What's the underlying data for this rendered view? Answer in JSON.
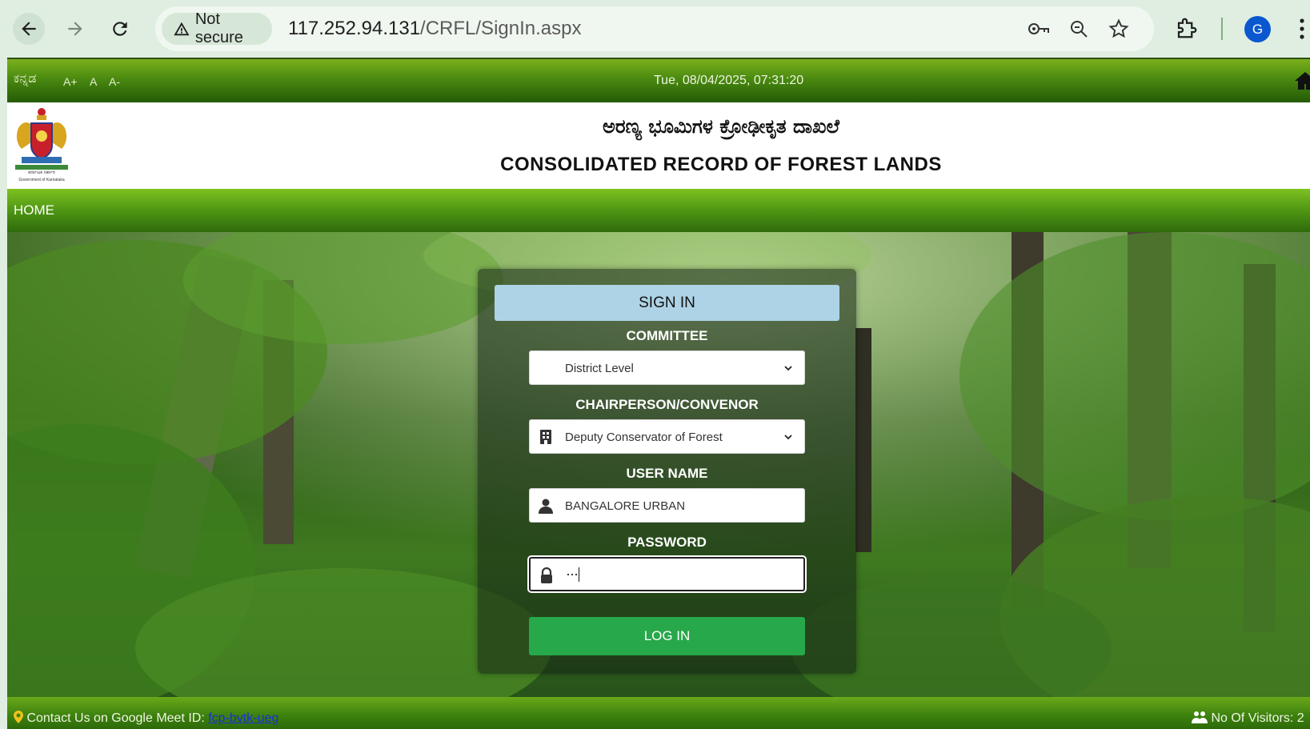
{
  "browser": {
    "security_label": "Not secure",
    "url_host": "117.252.94.131",
    "url_path": "/CRFL/SignIn.aspx",
    "profile_initial": "G"
  },
  "topbar": {
    "language_link": "ಕನ್ನಡ",
    "font_increase": "A+",
    "font_normal": "A",
    "font_decrease": "A-",
    "datetime": "Tue, 08/04/2025, 07:31:20"
  },
  "header": {
    "title_kannada": "ಅರಣ್ಯ ಭೂಮಿಗಳ ಕ್ರೋಢೀಕೃತ ದಾಖಲೆ",
    "title_english": "CONSOLIDATED RECORD OF FOREST LANDS",
    "emblem_caption_kn": "ಕರ್ನಾಟಕ ಸರ್ಕಾರ",
    "emblem_caption_en": "Government of Karnataka"
  },
  "menu": {
    "home": "HOME"
  },
  "login": {
    "heading": "SIGN IN",
    "committee_label": "COMMITTEE",
    "committee_value": "District Level",
    "chairperson_label": "CHAIRPERSON/CONVENOR",
    "chairperson_value": "Deputy Conservator of Forest",
    "username_label": "USER NAME",
    "username_value": "BANGALORE URBAN",
    "password_label": "PASSWORD",
    "password_value": "···",
    "login_button": "LOG IN"
  },
  "footer": {
    "contact_prefix": "Contact Us on Google Meet ID: ",
    "meet_id": "fcp-bvtk-ueg",
    "visitors": "No Of Visitors: 2"
  },
  "colors": {
    "green_bar": "#4a8a10",
    "signin_header": "#aed3e6",
    "login_button": "#27a84a",
    "chrome_bg": "#dfeee0"
  },
  "icons": [
    "back-icon",
    "forward-icon",
    "reload-icon",
    "warning-icon",
    "key-icon",
    "zoom-icon",
    "star-icon",
    "extensions-icon",
    "kebab-icon",
    "home-icon",
    "building-icon",
    "user-icon",
    "lock-icon",
    "chevron-down-icon",
    "map-pin-icon",
    "users-icon"
  ]
}
